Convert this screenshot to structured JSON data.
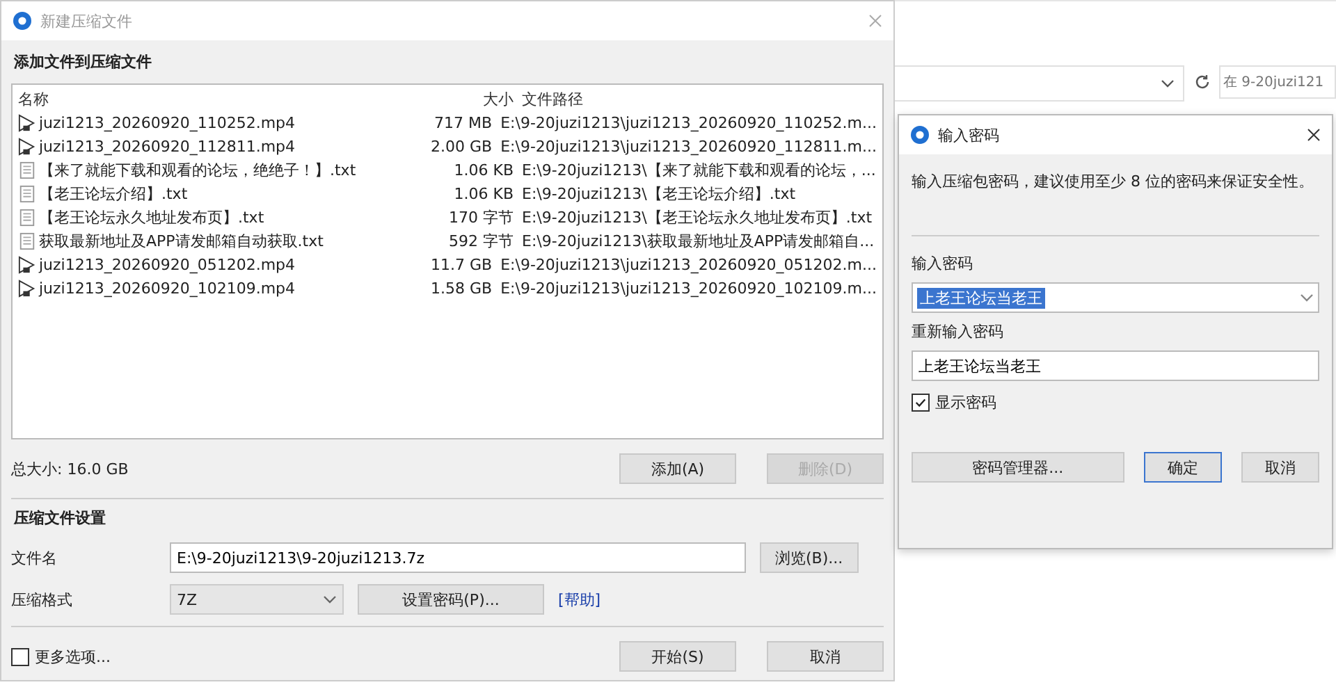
{
  "explorer": {
    "search_placeholder": "在 9-20juzi121"
  },
  "main_dialog": {
    "title": "新建压缩文件",
    "section_files": "添加文件到压缩文件",
    "columns": [
      "名称",
      "大小",
      "文件路径"
    ],
    "files": [
      {
        "kind": "video",
        "name": "juzi1213_20260920_110252.mp4",
        "size": "717 MB",
        "path": "E:\\9-20juzi1213\\juzi1213_20260920_110252.m..."
      },
      {
        "kind": "video",
        "name": "juzi1213_20260920_112811.mp4",
        "size": "2.00 GB",
        "path": "E:\\9-20juzi1213\\juzi1213_20260920_112811.m..."
      },
      {
        "kind": "text",
        "name": "【来了就能下载和观看的论坛，绝绝子！】.txt",
        "size": "1.06 KB",
        "path": "E:\\9-20juzi1213\\【来了就能下载和观看的论坛，..."
      },
      {
        "kind": "text",
        "name": "【老王论坛介绍】.txt",
        "size": "1.06 KB",
        "path": "E:\\9-20juzi1213\\【老王论坛介绍】.txt"
      },
      {
        "kind": "text",
        "name": "【老王论坛永久地址发布页】.txt",
        "size": "170 字节",
        "path": "E:\\9-20juzi1213\\【老王论坛永久地址发布页】.txt"
      },
      {
        "kind": "text",
        "name": "获取最新地址及APP请发邮箱自动获取.txt",
        "size": "592 字节",
        "path": "E:\\9-20juzi1213\\获取最新地址及APP请发邮箱自..."
      },
      {
        "kind": "video",
        "name": "juzi1213_20260920_051202.mp4",
        "size": "11.7 GB",
        "path": "E:\\9-20juzi1213\\juzi1213_20260920_051202.m..."
      },
      {
        "kind": "video",
        "name": "juzi1213_20260920_102109.mp4",
        "size": "1.58 GB",
        "path": "E:\\9-20juzi1213\\juzi1213_20260920_102109.m..."
      }
    ],
    "total_size": "总大小: 16.0 GB",
    "add_button": {
      "label": "添加(A)",
      "disabled": false
    },
    "remove_button": {
      "label": "删除(D)",
      "disabled": true
    },
    "section_settings": "压缩文件设置",
    "filename_label": "文件名",
    "filename_value": "E:\\9-20juzi1213\\9-20juzi1213.7z",
    "browse_button": "浏览(B)...",
    "format_label": "压缩格式",
    "format_value": "7Z",
    "password_button": "设置密码(P)...",
    "help_link": "[帮助]",
    "more_options": {
      "label": "更多选项...",
      "checked": false
    },
    "start_button": "开始(S)",
    "cancel_button": "取消"
  },
  "password_dialog": {
    "title": "输入密码",
    "hint": "输入压缩包密码，建议使用至少 8 位的密码来保证安全性。",
    "password_label": "输入密码",
    "password_value": "上老王论坛当老王",
    "confirm_label": "重新输入密码",
    "confirm_value": "上老王论坛当老王",
    "show_password": {
      "label": "显示密码",
      "checked": true
    },
    "manager_button": "密码管理器...",
    "ok_button": "确定",
    "cancel_button": "取消"
  }
}
